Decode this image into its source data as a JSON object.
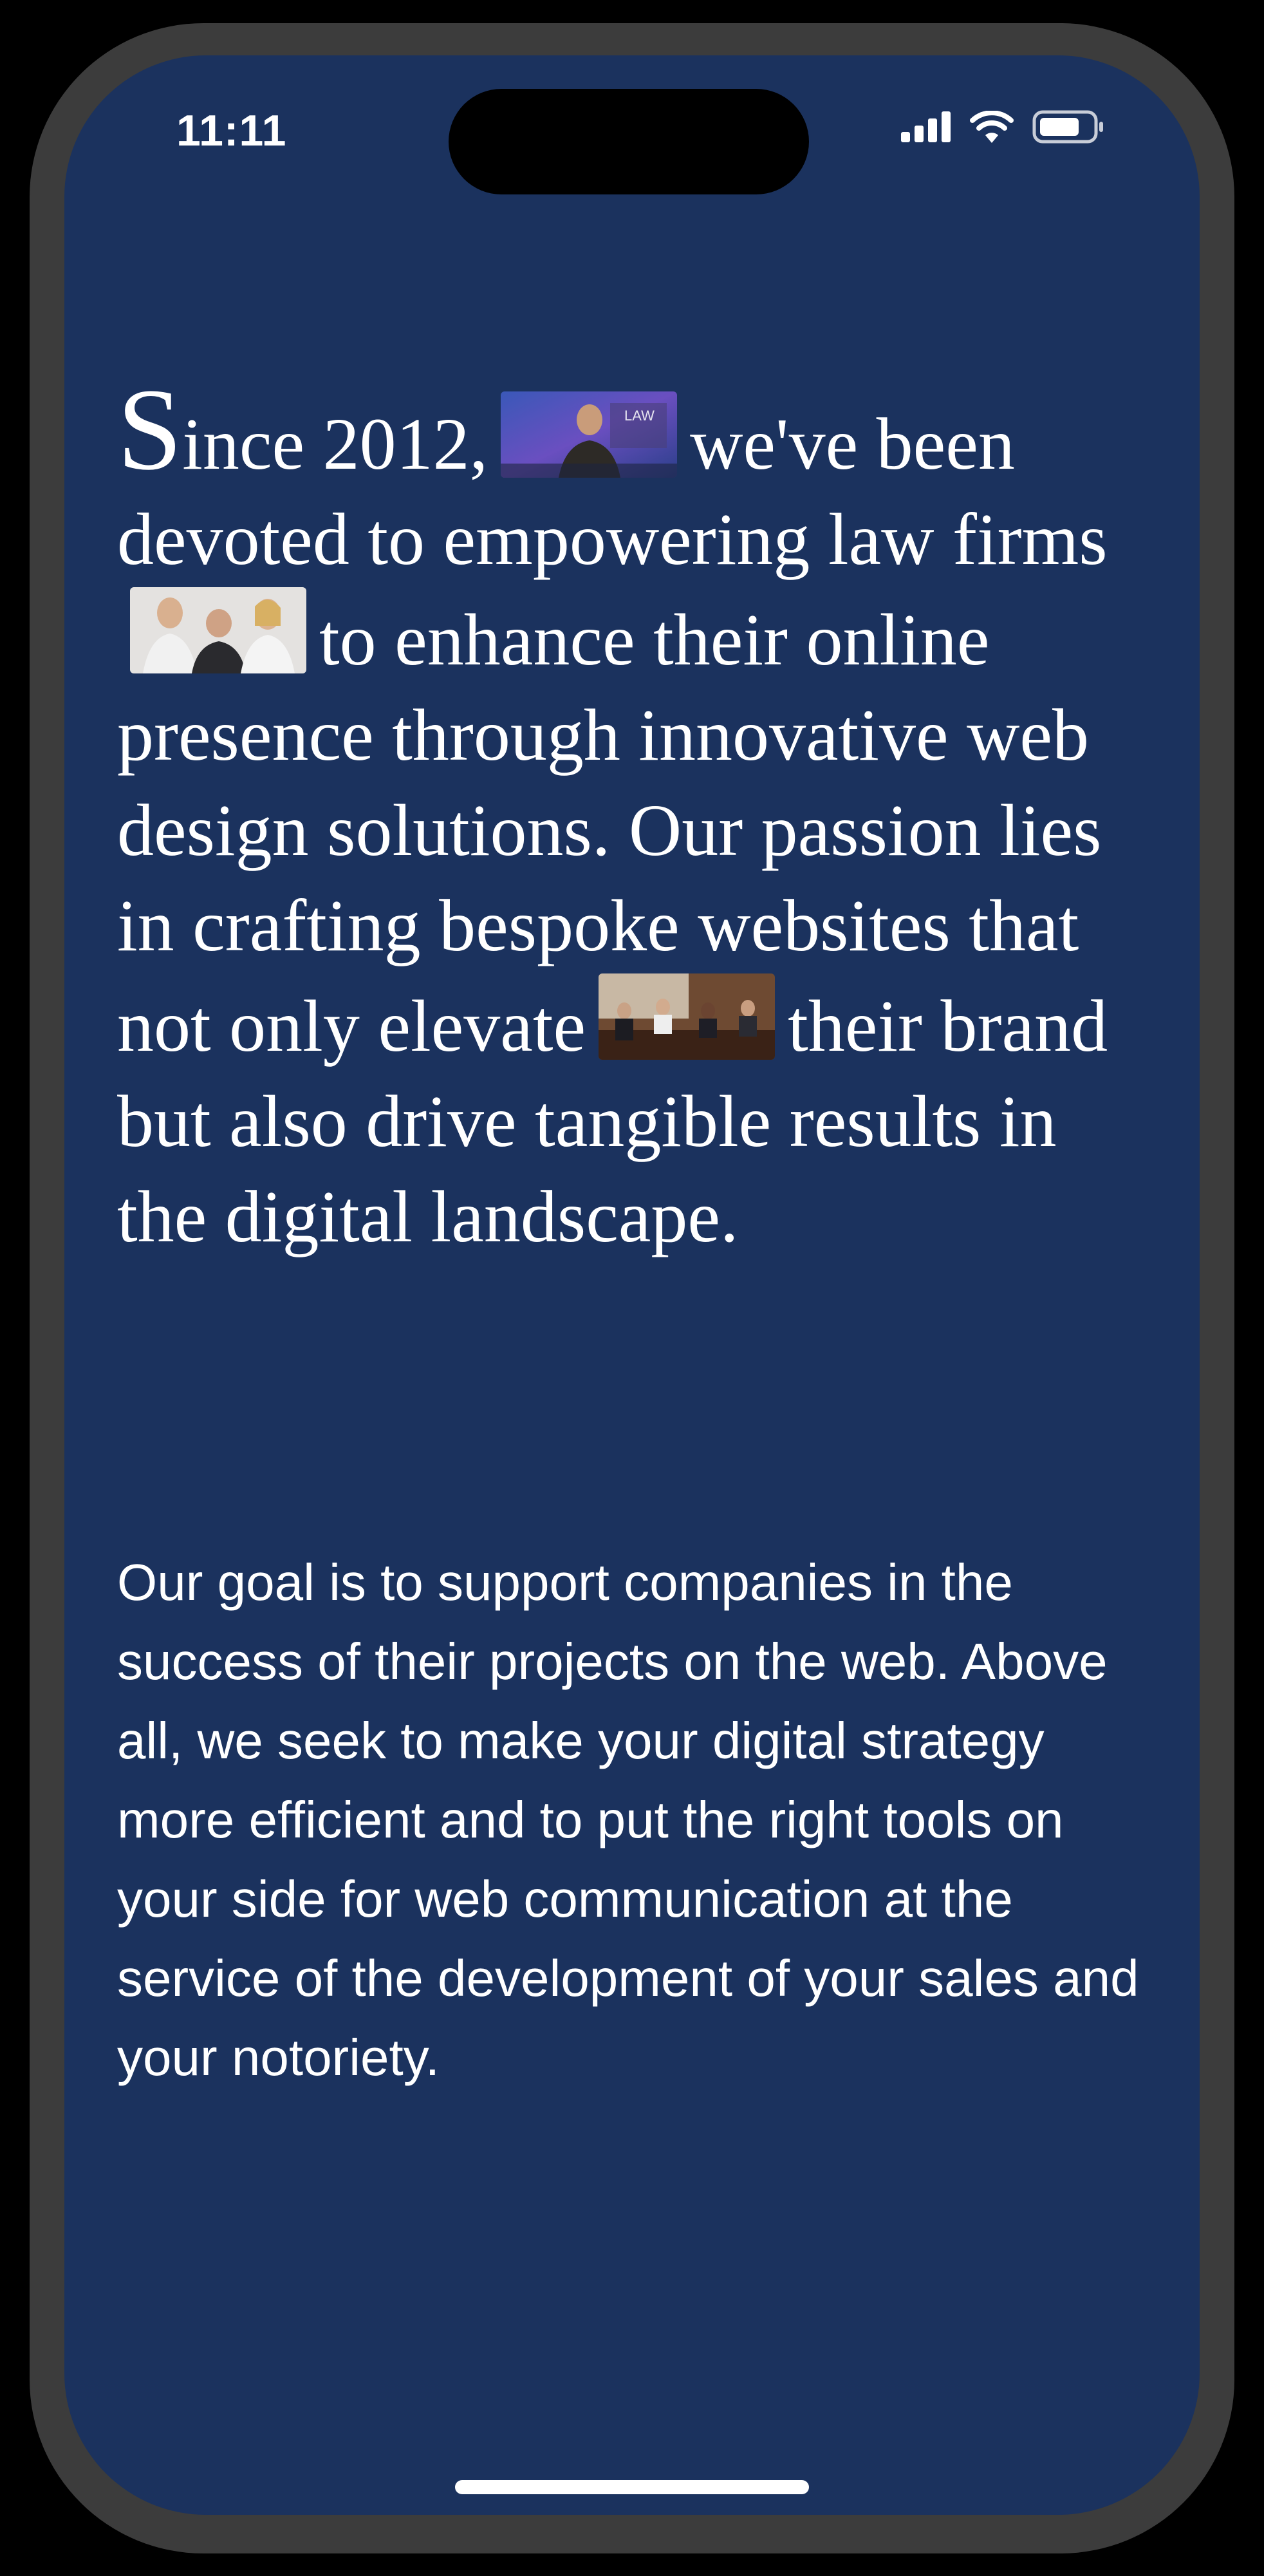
{
  "status_bar": {
    "time": "11:11",
    "icons": [
      "signal-icon",
      "wifi-icon",
      "battery-icon"
    ]
  },
  "hero": {
    "drop_cap": "S",
    "part1": "ince 2012,",
    "part2": "we've been devoted to empowering law firms",
    "part3": "to enhance their online presence through innovative web design solutions. Our passion lies in crafting bespoke websites that not only elevate",
    "part4": "their brand but also drive tangible results in the digital landscape.",
    "images": [
      "lawyer-summit-photo",
      "law-team-photo",
      "meeting-photo"
    ]
  },
  "body": {
    "text": "Our goal is to support companies in the success of their projects on the web. Above all, we seek to make your digital strategy more efficient and to put the right tools on your side for web communication at the service of the development of your sales and your notoriety."
  },
  "colors": {
    "background": "#1b325e",
    "frame": "#3c3c3c",
    "text": "#ffffff"
  }
}
